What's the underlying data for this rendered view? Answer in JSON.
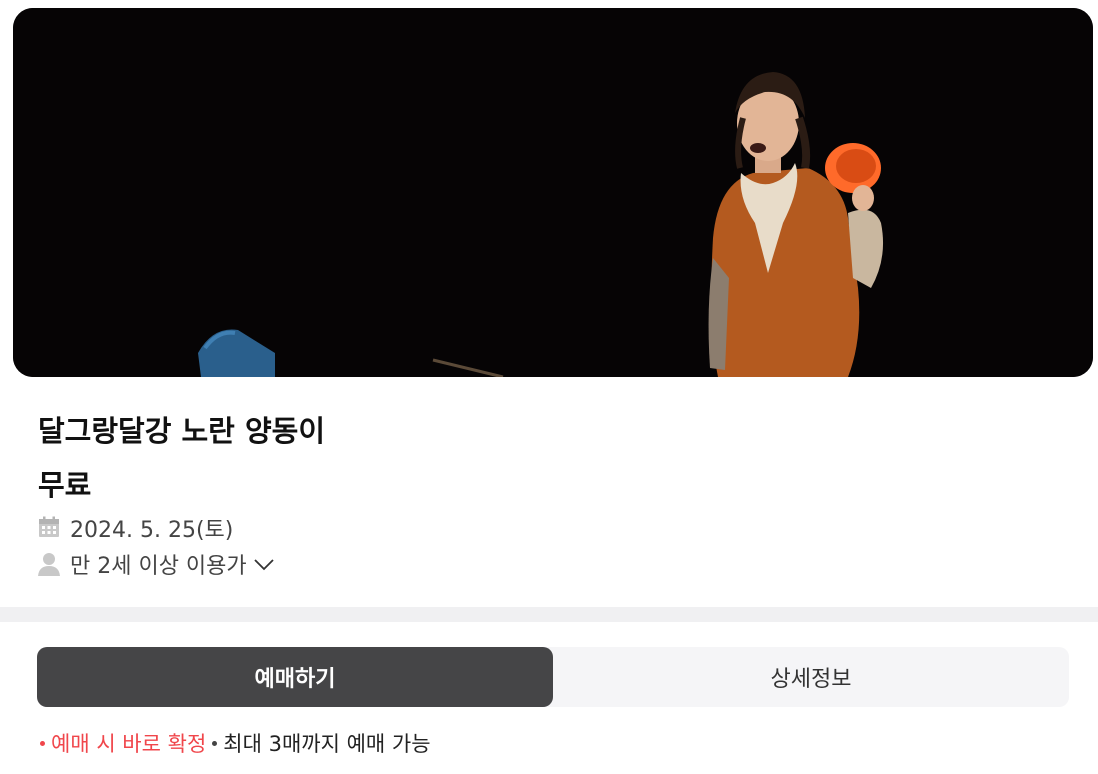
{
  "event": {
    "title": "달그랑달강 노란 양동이",
    "price": "무료",
    "date": "2024. 5. 25(토)",
    "age": "만 2세 이상 이용가"
  },
  "icons": {
    "date": "calendar-icon",
    "age": "person-icon",
    "expand": "chevron-down-icon"
  },
  "tabs": [
    {
      "label": "예매하기",
      "active": true
    },
    {
      "label": "상세정보",
      "active": false
    }
  ],
  "notice": {
    "confirm": "예매 시 바로 확정",
    "limit": "최대 3매까지 예매 가능"
  },
  "colors": {
    "accent_red": "#f0464b",
    "tab_active_bg": "#454547",
    "tab_bg": "#f5f5f7",
    "divider": "#f0f0f2"
  }
}
